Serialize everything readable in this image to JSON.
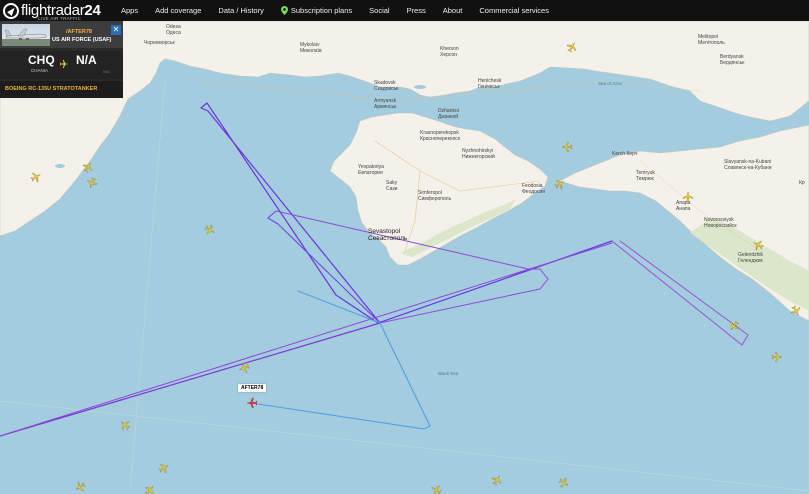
{
  "header": {
    "logo_main": "flightradar",
    "logo_num": "24",
    "logo_tagline": "LIVE AIR TRAFFIC",
    "nav": [
      "Apps",
      "Add coverage",
      "Data / History",
      "Subscription plans",
      "Social",
      "Press",
      "About",
      "Commercial services"
    ]
  },
  "flight_panel": {
    "callsign": "/AFTER78",
    "operator": "US AIR FORCE (USAF)",
    "from_code": "CHQ",
    "from_name": "CHANIA",
    "to_code": "N/A",
    "to_sub": "N/A",
    "aircraft_type": "BOEING RC-135U STRATOTANKER",
    "close_label": "✕"
  },
  "map": {
    "flight_label": "AFTER78",
    "places": {
      "odesa": "Одеса",
      "odesa_en": "Odesa",
      "chornomorsk": "Чорноморськ",
      "chornomorsk_en": "Chornomorsk",
      "mykolaiv": "Mykolaiv\nМиколаїв",
      "kherson": "Kherson\nХерсон",
      "melitopol": "Melitopol\nМелітополь",
      "berdyansk": "Berdyansk\nБердянськ",
      "skadovsk": "Skadovsk\nСкадовськ",
      "henichesk": "Henichesk\nГенічеськ",
      "armyansk": "Armyansk\nАрмянськ",
      "dzhankoi": "Dzhankoi\nДжанкой",
      "yevpatoriya": "Yevpatoriya\nЕвпатория",
      "simferopol": "Simferopol\nСимферополь",
      "sevastopol": "Sevastopol\nСевастополь",
      "feodosia": "Feodosia\nФеодосия",
      "kerch": "Kerch Керч",
      "anapa": "Anapa\nАнапа",
      "novorossiysk": "Novorossiysk\nНовороссийск",
      "slavyansk": "Slavyansk-na-Kubani\nСлавянск-на-Кубани",
      "temryuk": "Temryuk\nТемрюк",
      "gelendzhik": "Gelendzhik\nГеленджик",
      "krasnoperekopsk": "Krasnoperekopsk\nКрасноперекопск",
      "nyzhnohirskyi": "Nyzhnohirskyi\nНижнегорский",
      "saky": "Saky\nСаки",
      "kr": "Кр"
    },
    "seas": {
      "azov": "Sea of Azov",
      "black": "Black Sea"
    }
  }
}
